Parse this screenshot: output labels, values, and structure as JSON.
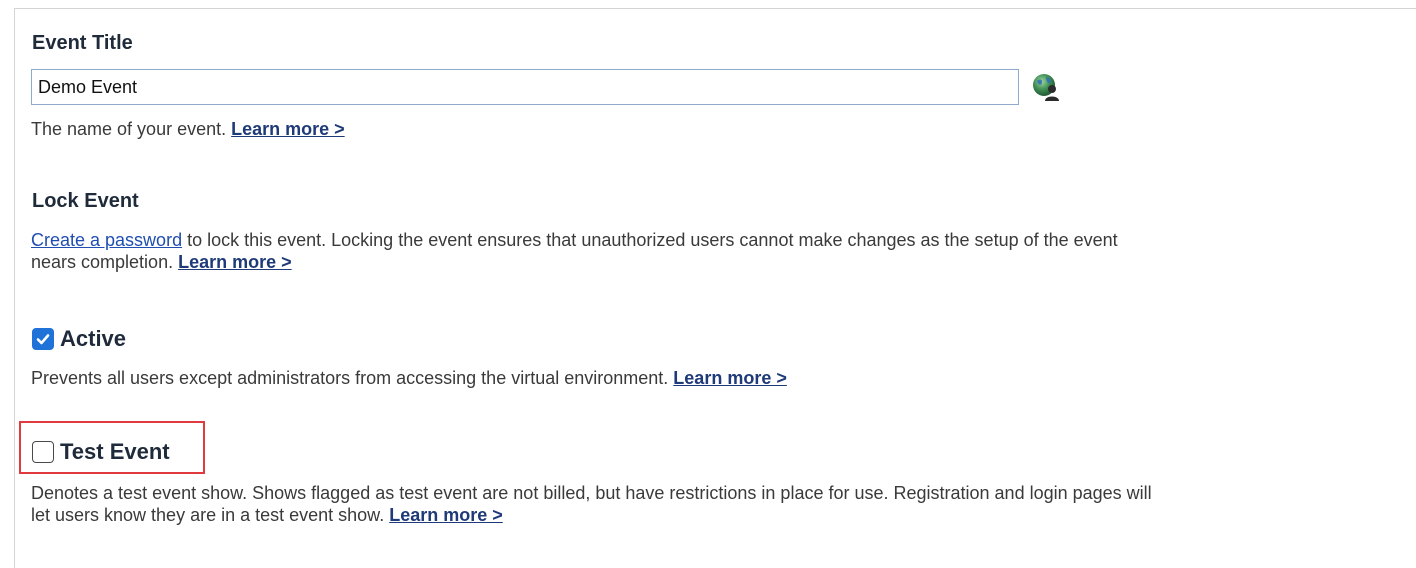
{
  "event_title": {
    "heading": "Event Title",
    "input_value": "Demo Event",
    "description": "The name of your event.",
    "learn_more": "Learn more >"
  },
  "lock_event": {
    "heading": "Lock Event",
    "link_text": "Create a password",
    "description_line1": " to lock this event. Locking the event ensures that unauthorized users cannot make changes as the setup of the event",
    "description_line2": "nears completion.",
    "learn_more": "Learn more >"
  },
  "active": {
    "label": "Active",
    "checked": true,
    "description": "Prevents all users except administrators from accessing the virtual environment.",
    "learn_more": "Learn more >"
  },
  "test_event": {
    "label": "Test Event",
    "checked": false,
    "description_line1": "Denotes a test event show. Shows flagged as test event are not billed, but have restrictions in place for use. Registration and login pages will",
    "description_line2": "let users know they are in a test event show.",
    "learn_more": "Learn more >"
  },
  "colors": {
    "checkbox_checked": "#1e72d8",
    "highlight_box": "#e0393e",
    "link": "#1f3a78"
  },
  "icons": {
    "title_action": "globe-user-icon",
    "active_checkbox": "checkmark-icon"
  }
}
